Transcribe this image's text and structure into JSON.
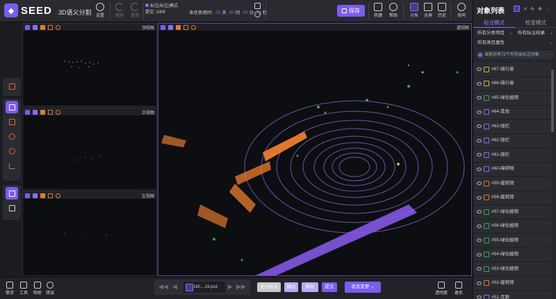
{
  "app": {
    "logo": "SEED",
    "title": "3D语义分割"
  },
  "toolbar": {
    "settings": "设置",
    "undo": "撤销",
    "redo": "重做",
    "mode_label": "标注(标注)模式",
    "submit_count": "提交: 1/8/9",
    "timer_label": "本任务用时:",
    "timer_days": "00",
    "timer_day_unit": "天",
    "timer_hours": "00",
    "timer_hour_unit": "时",
    "timer_minutes": "00",
    "timer_minute_unit": "分",
    "timer_seconds": "29",
    "timer_second_unit": "秒",
    "save": "保存",
    "hotkeys": "热键",
    "help": "帮助",
    "objects": "对象",
    "fullscreen": "全屏",
    "history": "历史",
    "collab": "协同"
  },
  "views": {
    "top": "顶视图",
    "front": "正视图",
    "left": "左视图",
    "perspective": "透视图"
  },
  "right_panel": {
    "title": "对象列表",
    "tabs": [
      "标注模式",
      "检查模式"
    ],
    "filter_category": "所有分类项目",
    "filter_result": "所有标注结果",
    "filter_attr": "所有类目属性",
    "notice": "当前共有72个可导出标注对象",
    "objects": [
      {
        "label": "#67-骑行者",
        "color": "#c8b84a"
      },
      {
        "label": "#66-骑行者",
        "color": "#c8b84a"
      },
      {
        "label": "#65-绿化植物",
        "color": "#3ea35a"
      },
      {
        "label": "#64-其他",
        "color": "#8a6cf5"
      },
      {
        "label": "#63-围栏",
        "color": "#8a6cf5"
      },
      {
        "label": "#62-围栏",
        "color": "#8a6cf5"
      },
      {
        "label": "#61-围栏",
        "color": "#8a6cf5"
      },
      {
        "label": "#60-障碍物",
        "color": "#8a6cf5"
      },
      {
        "label": "#59-建筑物",
        "color": "#e0772e"
      },
      {
        "label": "#58-建筑物",
        "color": "#e0772e"
      },
      {
        "label": "#57-绿化植物",
        "color": "#3ea35a"
      },
      {
        "label": "#56-绿化植物",
        "color": "#3ea35a"
      },
      {
        "label": "#55-绿化植物",
        "color": "#3ea35a"
      },
      {
        "label": "#54-绿化植物",
        "color": "#3ea35a"
      },
      {
        "label": "#53-绿化植物",
        "color": "#3ea35a"
      },
      {
        "label": "#52-建筑物",
        "color": "#e0772e"
      },
      {
        "label": "#51-互联",
        "color": "#8a6cf5"
      }
    ]
  },
  "bottom": {
    "requirements": "需求",
    "tools": "工具",
    "shortcuts": "映射",
    "errors": "错误",
    "file": "160....19.pcd",
    "invalid": "无法标注",
    "skip": "跳过",
    "release": "释放",
    "submit": "提交",
    "status_change": "状态变更",
    "transparency": "透明度",
    "color": "着色"
  }
}
